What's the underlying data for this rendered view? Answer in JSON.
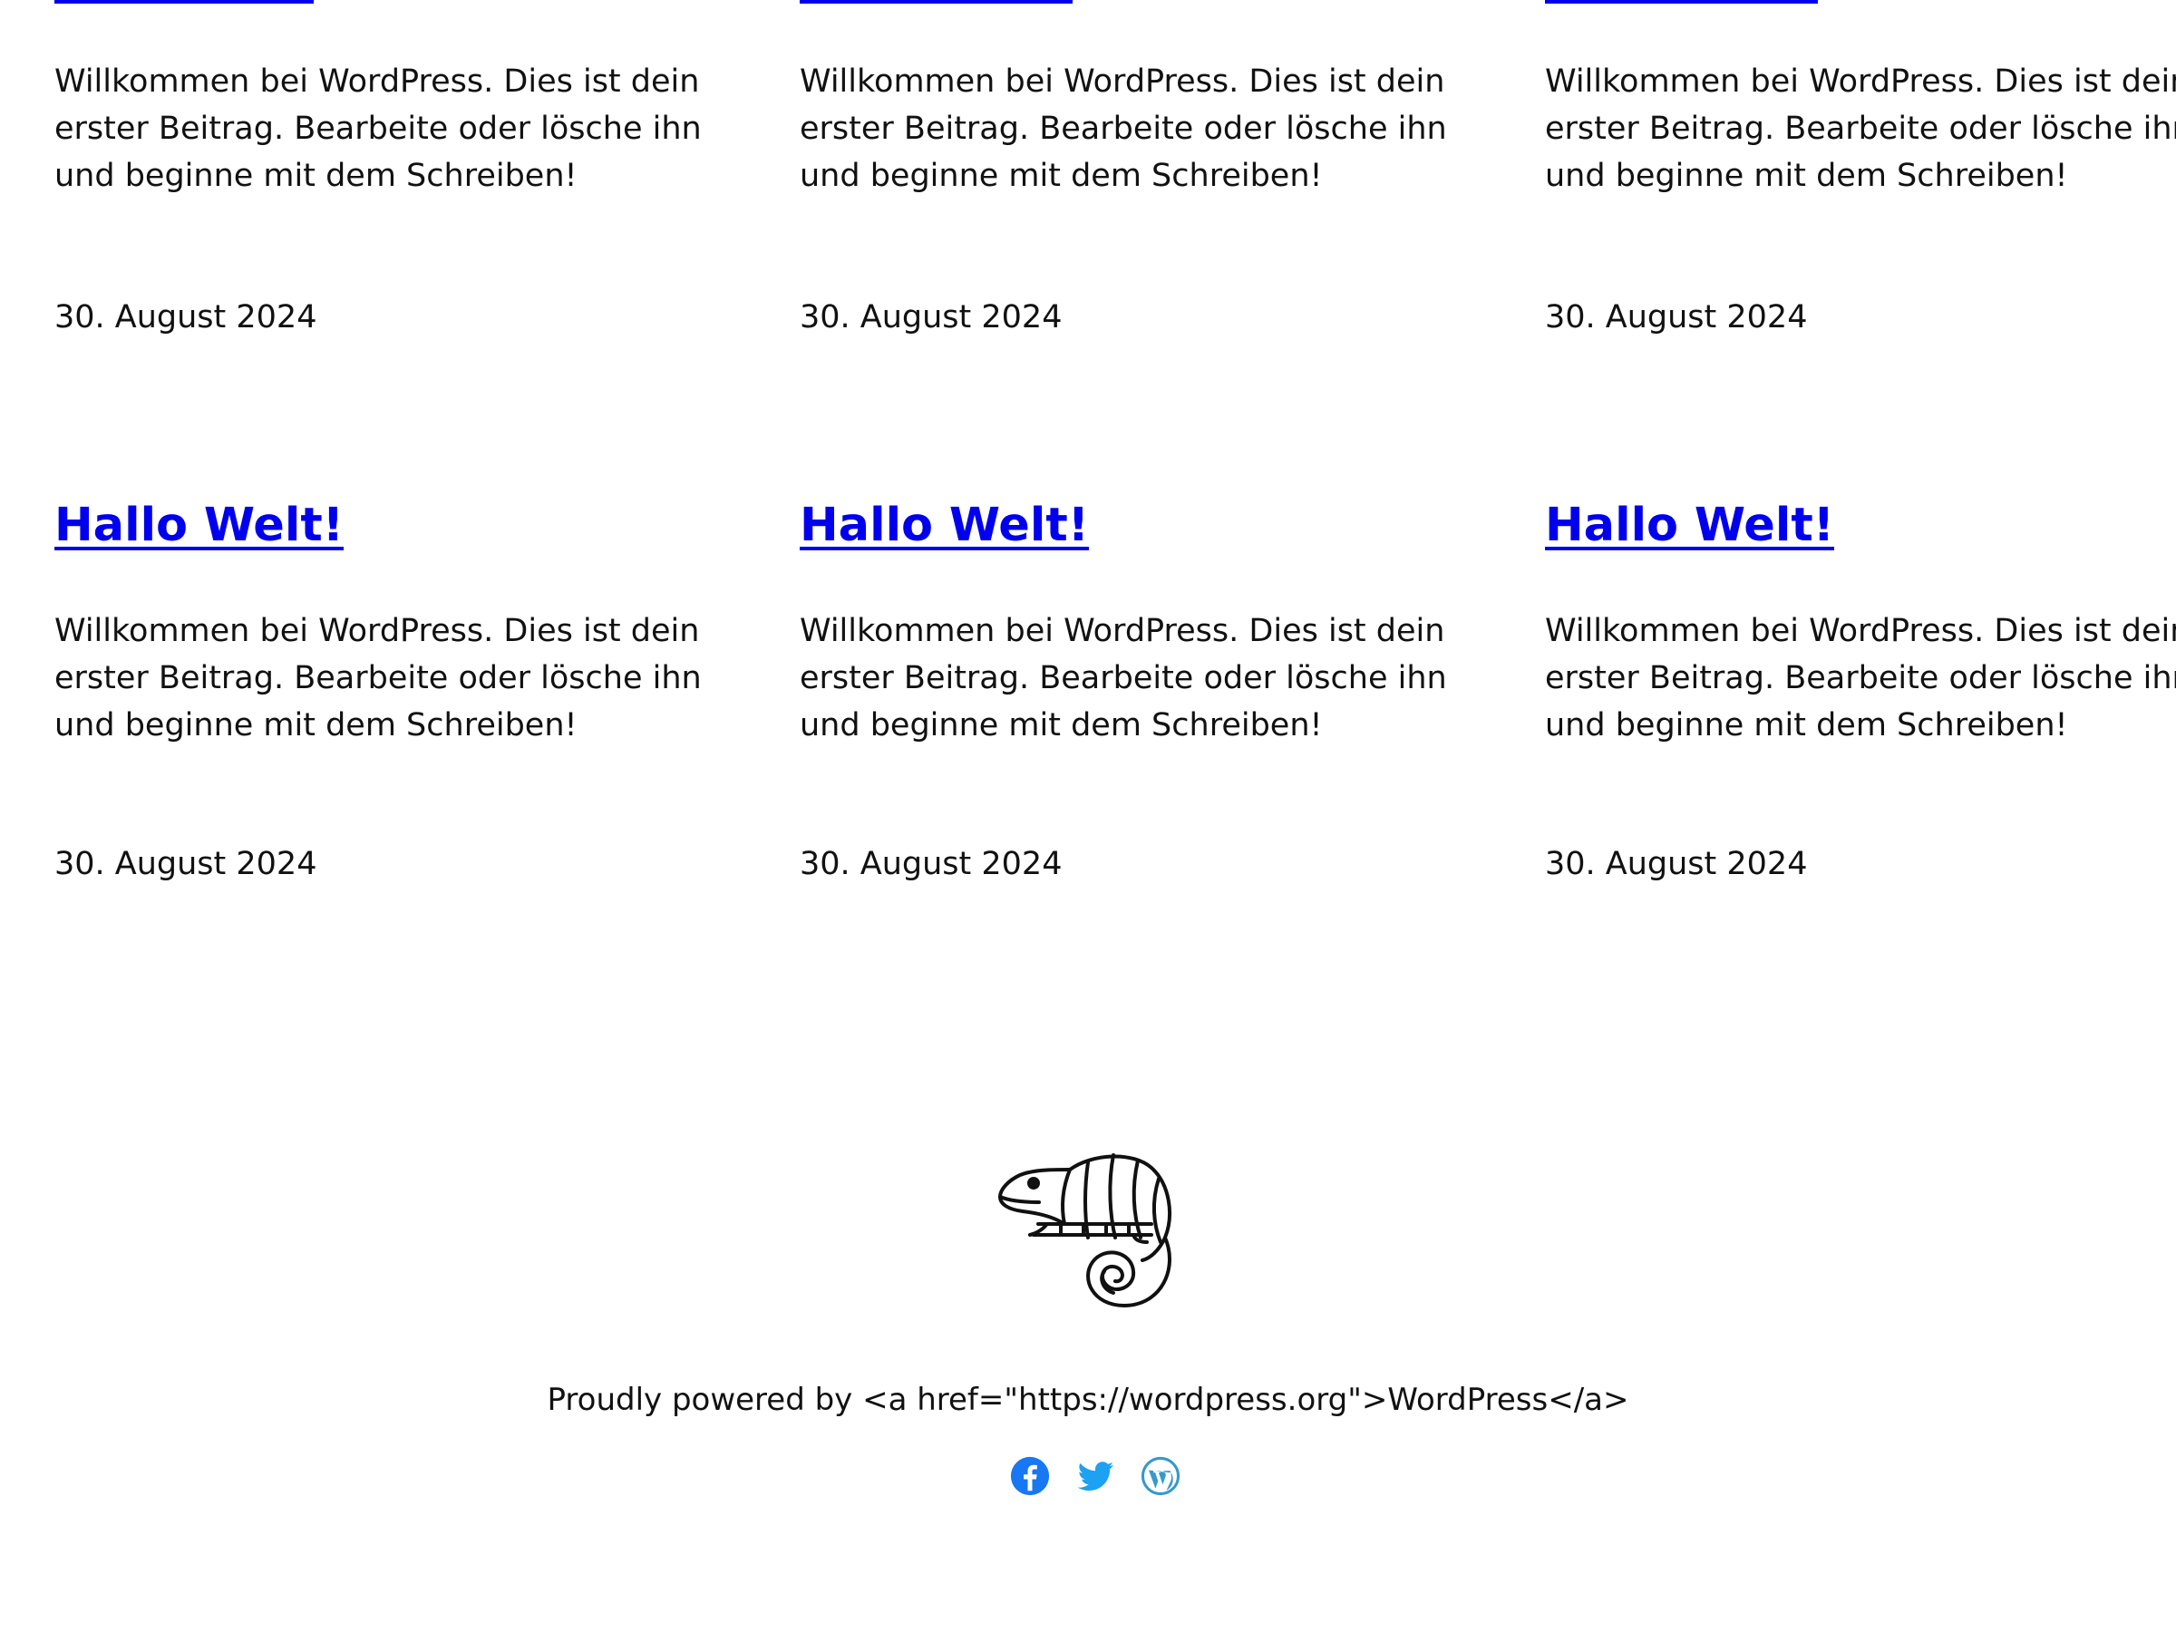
{
  "posts": [
    {
      "title": "",
      "excerpt": "Willkommen bei WordPress. Dies ist dein erster Beitrag. Bearbeite oder lösche ihn und beginne mit dem Schreiben!",
      "date": "30. August 2024"
    },
    {
      "title": "",
      "excerpt": "Willkommen bei WordPress. Dies ist dein erster Beitrag. Bearbeite oder lösche ihn und beginne mit dem Schreiben!",
      "date": "30. August 2024"
    },
    {
      "title": "",
      "excerpt": "Willkommen bei WordPress. Dies ist dein erster Beitrag. Bearbeite oder lösche ihn und beginne mit dem Schreiben!",
      "date": "30. August 2024"
    },
    {
      "title": "Hallo Welt!",
      "excerpt": "Willkommen bei WordPress. Dies ist dein erster Beitrag. Bearbeite oder lösche ihn und beginne mit dem Schreiben!",
      "date": "30. August 2024"
    },
    {
      "title": "Hallo Welt!",
      "excerpt": "Willkommen bei WordPress. Dies ist dein erster Beitrag. Bearbeite oder lösche ihn und beginne mit dem Schreiben!",
      "date": "30. August 2024"
    },
    {
      "title": "Hallo Welt!",
      "excerpt": "Willkommen bei WordPress. Dies ist dein erster Beitrag. Bearbeite oder lösche ihn und beginne mit dem Schreiben!",
      "date": "30. August 2024"
    }
  ],
  "footer": {
    "logo_icon": "chameleon-logo-icon",
    "credit_text": "Proudly powered by <a href=\"https://wordpress.org\">WordPress</a>",
    "social_links": [
      {
        "icon": "facebook-icon",
        "color": "#1877f2"
      },
      {
        "icon": "twitter-icon",
        "color": "#1da1f2"
      },
      {
        "icon": "wordpress-icon",
        "color": "#3499cd"
      }
    ]
  },
  "colors": {
    "link": "#0000ee",
    "text": "#111111",
    "background": "#ffffff"
  }
}
